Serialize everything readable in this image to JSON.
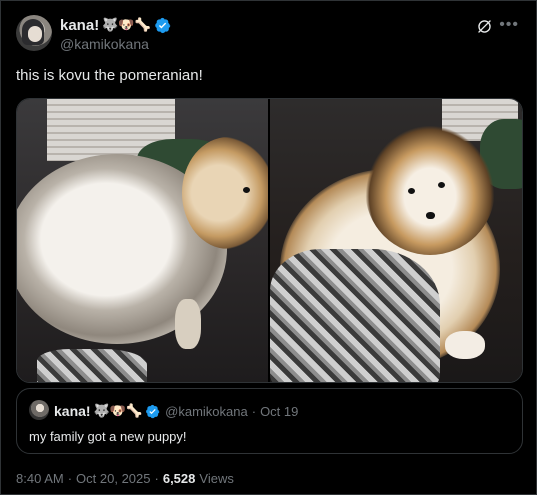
{
  "author": {
    "display_name": "kana!",
    "emoji": "🐺🐶🦴",
    "handle": "@kamikokana"
  },
  "tweet": {
    "text": "this is kovu the pomeranian!"
  },
  "quote": {
    "display_name": "kana!",
    "emoji": "🐺🐶🦴",
    "handle": "@kamikokana",
    "dot": "·",
    "date": "Oct 19",
    "text": "my family got a new puppy!"
  },
  "meta": {
    "time": "8:40 AM",
    "dot1": "·",
    "date": "Oct 20, 2025",
    "dot2": "·",
    "views_count": "6,528",
    "views_label": "Views"
  },
  "colors": {
    "background": "#000000",
    "text": "#e7e9ea",
    "secondary": "#71767b",
    "verified": "#1d9bf0",
    "border": "#2f3336"
  },
  "icons": [
    "verified-badge-icon",
    "grok-icon",
    "more-icon"
  ]
}
